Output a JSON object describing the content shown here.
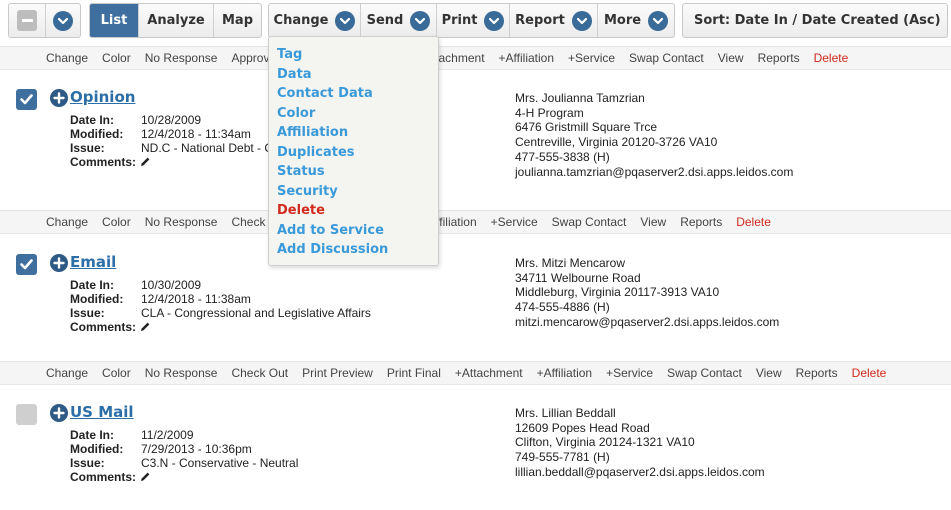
{
  "toolbar": {
    "views": [
      "List",
      "Analyze",
      "Map"
    ],
    "active_view": "List",
    "menus": [
      "Change",
      "Send",
      "Print",
      "Report",
      "More"
    ],
    "sort_label": "Sort: Date In / Date Created (Asc)"
  },
  "change_dropdown": {
    "items": [
      {
        "label": "Tag"
      },
      {
        "label": "Data"
      },
      {
        "label": "Contact Data"
      },
      {
        "label": "Color"
      },
      {
        "label": "Affiliation"
      },
      {
        "label": "Duplicates"
      },
      {
        "label": "Status"
      },
      {
        "label": "Security"
      },
      {
        "label": "Delete",
        "danger": true
      },
      {
        "label": "Add to Service"
      },
      {
        "label": "Add Discussion"
      }
    ]
  },
  "action_bars": [
    [
      "Change",
      "Color",
      "No Response",
      "Approve",
      "",
      "",
      "",
      "attachment",
      "+Affiliation",
      "+Service",
      "Swap Contact",
      "View",
      "Reports",
      "Delete"
    ],
    [
      "Change",
      "Color",
      "No Response",
      "Check Out",
      "",
      "",
      "",
      "ffiliation",
      "+Service",
      "Swap Contact",
      "View",
      "Reports",
      "Delete"
    ],
    [
      "Change",
      "Color",
      "No Response",
      "Check Out",
      "Print Preview",
      "Print Final",
      "+Attachment",
      "+Affiliation",
      "+Service",
      "Swap Contact",
      "View",
      "Reports",
      "Delete"
    ]
  ],
  "field_labels": {
    "date_in": "Date In:",
    "modified": "Modified:",
    "issue": "Issue:",
    "comments": "Comments:"
  },
  "records": [
    {
      "title": "Opinion",
      "checked": true,
      "date_in": "10/28/2009",
      "modified": "12/4/2018 - 11:34am",
      "issue": "ND.C - National Debt - C",
      "contact": [
        "Mrs. Joulianna Tamzrian",
        "4-H Program",
        "6476 Gristmill Square Trce",
        "Centreville, Virginia 20120-3726 VA10",
        "477-555-3838 (H)",
        "joulianna.tamzrian@pqaserver2.dsi.apps.leidos.com"
      ]
    },
    {
      "title": "Email",
      "checked": true,
      "date_in": "10/30/2009",
      "modified": "12/4/2018 - 11:38am",
      "issue": "CLA - Congressional and Legislative Affairs",
      "contact": [
        "Mrs. Mitzi Mencarow",
        "34711 Welbourne Road",
        "Middleburg, Virginia 20117-3913 VA10",
        "474-555-4886 (H)",
        "mitzi.mencarow@pqaserver2.dsi.apps.leidos.com"
      ]
    },
    {
      "title": "US Mail",
      "checked": false,
      "date_in": "11/2/2009",
      "modified": "7/29/2013 - 10:36pm",
      "issue": "C3.N - Conservative - Neutral",
      "contact": [
        "Mrs. Lillian Beddall",
        "12609 Popes Head Road",
        "Clifton, Virginia 20124-1321 VA10",
        "749-555-7781 (H)",
        "lillian.beddall@pqaserver2.dsi.apps.leidos.com"
      ]
    }
  ],
  "colors": {
    "accent": "#3f6f9f",
    "link": "#2b6ea8",
    "menu_link": "#3a9ad9",
    "danger": "#d12a1e"
  }
}
